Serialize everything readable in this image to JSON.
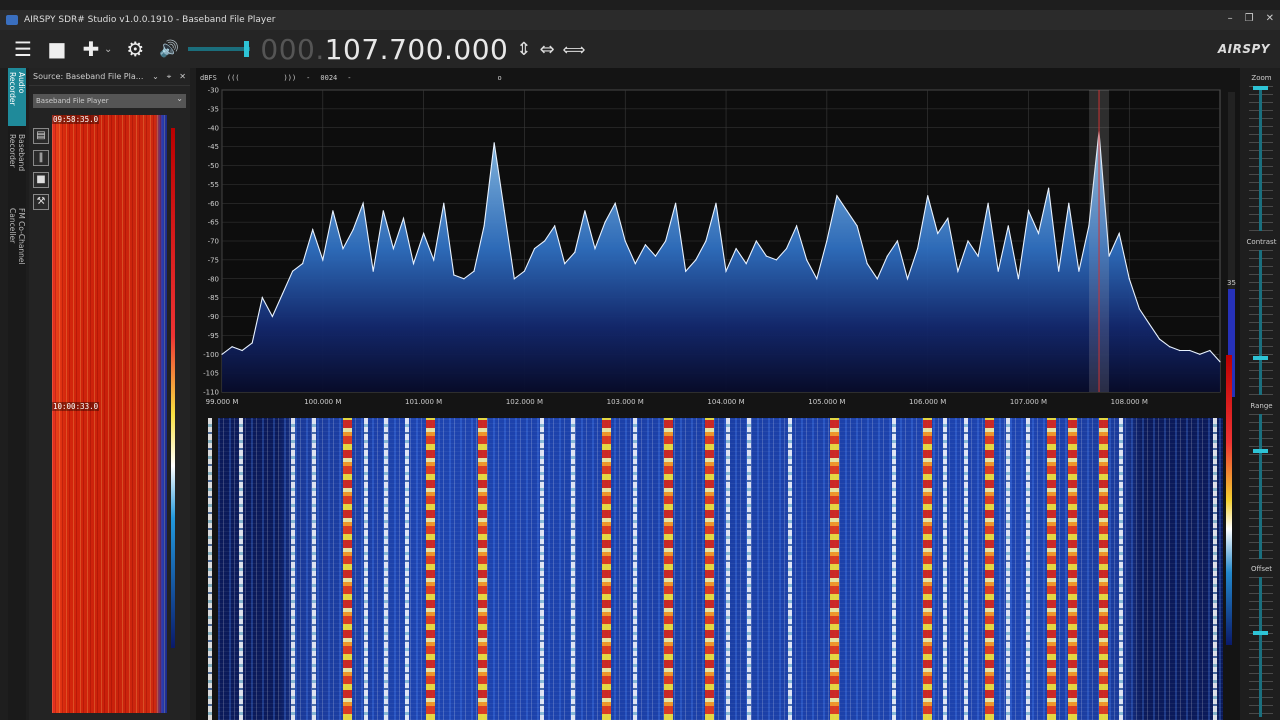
{
  "window": {
    "title": "AIRSPY SDR# Studio v1.0.0.1910 - Baseband File Player",
    "controls": [
      "–",
      "❐",
      "✕"
    ]
  },
  "toolbar": {
    "menu_icon": "☰",
    "stop_icon": "■",
    "add_icon": "✚",
    "add_dropdown_icon": "⌄",
    "settings_icon": "⚙",
    "volume_icon": "🔊",
    "volume_level": 0.95,
    "frequency_dim": "000.",
    "frequency_main": "107.700.000",
    "updown_icon": "⇕",
    "leftright_icon": "⇔",
    "span_icon": "⟺",
    "brand": "AIRSPY"
  },
  "side_tabs": [
    "Audio Recorder",
    "Baseband Recorder",
    "FM Co-Channel Canceller"
  ],
  "source_panel": {
    "header": "Source: Baseband File Pla...",
    "header_controls": [
      "⌄",
      "⌖",
      "✕"
    ],
    "selected_source": "Baseband File Player",
    "timestamps": [
      "09:58:35.0",
      "10:00:33.0"
    ]
  },
  "spectrum": {
    "info_dbfs": "dBFS",
    "info_left": "(((",
    "info_right": ")))",
    "info_dash": "-",
    "info_code": "0024",
    "info_dash2": "-",
    "info_o": "o",
    "side_value": "35"
  },
  "chart_data": {
    "type": "area",
    "ylabel": "dBFS",
    "ylim": [
      -110,
      -30
    ],
    "yticks": [
      "-30",
      "-35",
      "-40",
      "-45",
      "-50",
      "-55",
      "-60",
      "-65",
      "-70",
      "-75",
      "-80",
      "-85",
      "-90",
      "-95",
      "-100",
      "-105",
      "-110"
    ],
    "xlim": [
      99.0,
      108.9
    ],
    "xticks": [
      "99.000 M",
      "100.000 M",
      "101.000 M",
      "102.000 M",
      "103.000 M",
      "104.000 M",
      "105.000 M",
      "106.000 M",
      "107.000 M",
      "108.000 M"
    ],
    "grid": true,
    "tuned_mhz": 107.7,
    "series": [
      {
        "x": [
          99.0,
          99.1,
          99.2,
          99.3,
          99.4,
          99.5,
          99.6,
          99.7,
          99.8,
          99.9,
          100.0,
          100.1,
          100.2,
          100.3,
          100.4,
          100.5,
          100.6,
          100.7,
          100.8,
          100.9,
          101.0,
          101.1,
          101.2,
          101.3,
          101.4,
          101.5,
          101.6,
          101.7,
          101.8,
          101.9,
          102.0,
          102.1,
          102.2,
          102.3,
          102.4,
          102.5,
          102.6,
          102.7,
          102.8,
          102.9,
          103.0,
          103.1,
          103.2,
          103.3,
          103.4,
          103.5,
          103.6,
          103.7,
          103.8,
          103.9,
          104.0,
          104.1,
          104.2,
          104.3,
          104.4,
          104.5,
          104.6,
          104.7,
          104.8,
          104.9,
          105.0,
          105.1,
          105.2,
          105.3,
          105.4,
          105.5,
          105.6,
          105.7,
          105.8,
          105.9,
          106.0,
          106.1,
          106.2,
          106.3,
          106.4,
          106.5,
          106.6,
          106.7,
          106.8,
          106.9,
          107.0,
          107.1,
          107.2,
          107.3,
          107.4,
          107.5,
          107.6,
          107.7,
          107.8,
          107.9,
          108.0,
          108.1,
          108.2,
          108.3,
          108.4,
          108.5,
          108.6,
          108.7,
          108.8,
          108.9
        ],
        "values": [
          -100,
          -98,
          -99,
          -97,
          -85,
          -90,
          -84,
          -78,
          -76,
          -67,
          -75,
          -62,
          -72,
          -67,
          -60,
          -78,
          -62,
          -72,
          -64,
          -76,
          -68,
          -75,
          -60,
          -79,
          -80,
          -78,
          -66,
          -44,
          -62,
          -80,
          -78,
          -72,
          -70,
          -66,
          -76,
          -73,
          -62,
          -72,
          -65,
          -60,
          -70,
          -76,
          -71,
          -74,
          -70,
          -60,
          -78,
          -75,
          -70,
          -60,
          -78,
          -72,
          -76,
          -70,
          -74,
          -75,
          -72,
          -66,
          -75,
          -80,
          -70,
          -58,
          -62,
          -66,
          -76,
          -80,
          -74,
          -70,
          -80,
          -72,
          -58,
          -68,
          -64,
          -78,
          -70,
          -74,
          -60,
          -78,
          -66,
          -80,
          -62,
          -68,
          -56,
          -78,
          -60,
          -78,
          -66,
          -41,
          -74,
          -68,
          -80,
          -88,
          -92,
          -96,
          -98,
          -99,
          -99,
          -100,
          -99,
          -102
        ]
      }
    ]
  },
  "right_panel": {
    "zoom_label": "Zoom",
    "contrast_label": "Contrast",
    "range_label": "Range",
    "offset_label": "Offset",
    "zoom_level": 0.0,
    "contrast_level": 0.75,
    "range_level": 0.25,
    "offset_level": 0.4
  }
}
